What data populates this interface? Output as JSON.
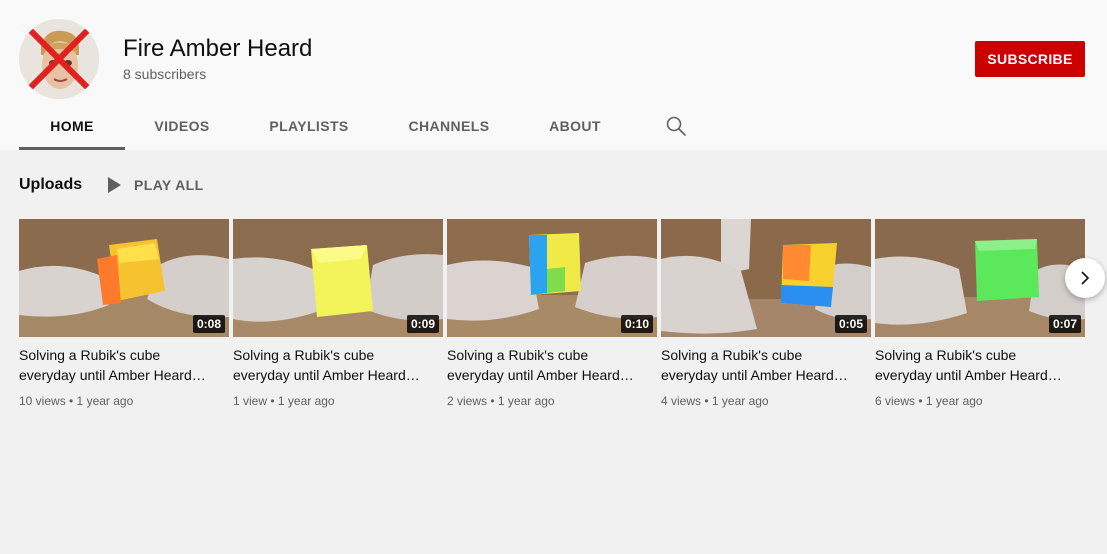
{
  "channel": {
    "name": "Fire Amber Heard",
    "subscribers": "8 subscribers",
    "subscribe_label": "SUBSCRIBE",
    "avatar_icon": "crossed-out-face-avatar"
  },
  "tabs": [
    {
      "label": "HOME",
      "active": true
    },
    {
      "label": "VIDEOS",
      "active": false
    },
    {
      "label": "PLAYLISTS",
      "active": false
    },
    {
      "label": "CHANNELS",
      "active": false
    },
    {
      "label": "ABOUT",
      "active": false
    }
  ],
  "section": {
    "title": "Uploads",
    "play_all_label": "PLAY ALL"
  },
  "videos": [
    {
      "title": "Solving a Rubik's cube everyday until Amber Heard is fired",
      "duration": "0:08",
      "meta": "10 views • 1 year ago",
      "cube": "orange-yellow"
    },
    {
      "title": "Solving a Rubik's cube everyday until Amber Heard is fired",
      "duration": "0:09",
      "meta": "1 view • 1 year ago",
      "cube": "yellow"
    },
    {
      "title": "Solving a Rubik's cube everyday until Amber Heard is fired",
      "duration": "0:10",
      "meta": "2 views • 1 year ago",
      "cube": "blue-yellow"
    },
    {
      "title": "Solving a Rubik's cube everyday until Amber Heard is fired",
      "duration": "0:05",
      "meta": "4 views • 1 year ago",
      "cube": "orange-blue"
    },
    {
      "title": "Solving a Rubik's cube everyday until Amber Heard is fired",
      "duration": "0:07",
      "meta": "6 views • 1 year ago",
      "cube": "green"
    }
  ],
  "colors": {
    "subscribe": "#cc0000",
    "header_bg": "#f9f9f9",
    "page_bg": "#f1f1f1"
  }
}
